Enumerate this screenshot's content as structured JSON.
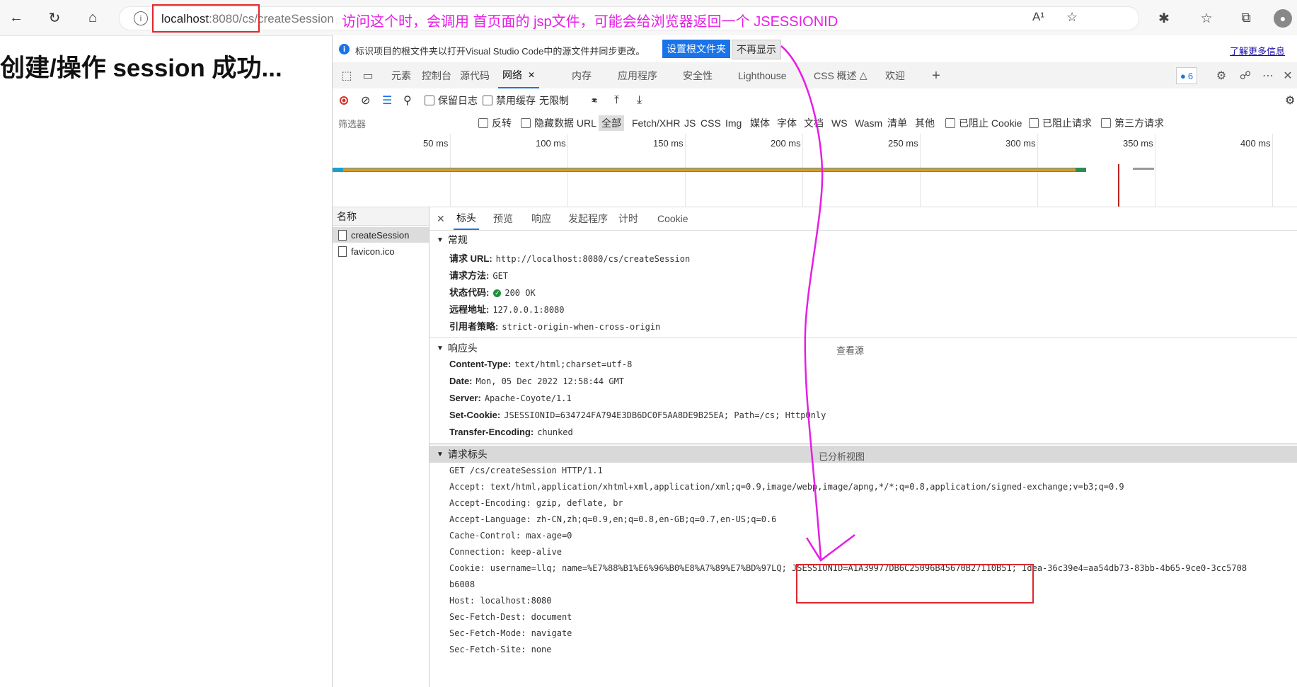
{
  "browser": {
    "url_host": "localhost",
    "url_rest_dim": ":8080/cs/",
    "url_path": "createSession",
    "annotation": "访问这个时，会调用 首页面的 jsp文件，可能会给浏览器返回一个 JSESSIONID",
    "read_aloud": "A¹"
  },
  "page": {
    "heading": "创建/操作 session 成功..."
  },
  "devtools": {
    "infobar": {
      "text": "标识项目的根文件夹以打开Visual Studio Code中的源文件并同步更改。",
      "set_root_button": "设置根文件夹",
      "dismiss_button": "不再显示",
      "learn_more": "了解更多信息"
    },
    "tabs": [
      "元素",
      "控制台",
      "源代码",
      "网络",
      "内存",
      "应用程序",
      "安全性",
      "Lighthouse",
      "CSS 概述",
      "欢迎"
    ],
    "active_tab": "网络",
    "issues_count": "6",
    "toolbar": {
      "preserve_log": "保留日志",
      "disable_cache": "禁用缓存",
      "throttle": "无限制"
    },
    "filter": {
      "placeholder": "筛选器",
      "invert": "反转",
      "hide_data_urls": "隐藏数据 URL",
      "types": [
        "全部",
        "Fetch/XHR",
        "JS",
        "CSS",
        "Img",
        "媒体",
        "字体",
        "文档",
        "WS",
        "Wasm",
        "清单",
        "其他"
      ],
      "blocked_cookies": "已阻止 Cookie",
      "blocked_requests": "已阻止请求",
      "third_party": "第三方请求"
    },
    "timeline_ticks": [
      "50 ms",
      "100 ms",
      "150 ms",
      "200 ms",
      "250 ms",
      "300 ms",
      "350 ms",
      "400 ms"
    ],
    "requests": {
      "header": "名称",
      "items": [
        "createSession",
        "favicon.ico"
      ]
    },
    "detail_tabs": [
      "标头",
      "预览",
      "响应",
      "发起程序",
      "计时",
      "Cookie"
    ],
    "general": {
      "title": "常规",
      "request_url_label": "请求 URL:",
      "request_url": "http://localhost:8080/cs/createSession",
      "method_label": "请求方法:",
      "method": "GET",
      "status_label": "状态代码:",
      "status": "200 OK",
      "remote_label": "远程地址:",
      "remote": "127.0.0.1:8080",
      "referrer_label": "引用者策略:",
      "referrer": "strict-origin-when-cross-origin"
    },
    "response_headers": {
      "title": "响应头",
      "view_source": "查看源",
      "items": [
        {
          "k": "Content-Type:",
          "v": "text/html;charset=utf-8"
        },
        {
          "k": "Date:",
          "v": "Mon, 05 Dec 2022 12:58:44 GMT"
        },
        {
          "k": "Server:",
          "v": "Apache-Coyote/1.1"
        },
        {
          "k": "Set-Cookie:",
          "v": "JSESSIONID=634724FA794E3DB6DC0F5AA8DE9B25EA; Path=/cs; HttpOnly"
        },
        {
          "k": "Transfer-Encoding:",
          "v": "chunked"
        }
      ]
    },
    "request_headers": {
      "title": "请求标头",
      "parsed_view": "已分析视图",
      "lines": [
        "GET /cs/createSession HTTP/1.1",
        "Accept: text/html,application/xhtml+xml,application/xml;q=0.9,image/webp,image/apng,*/*;q=0.8,application/signed-exchange;v=b3;q=0.9",
        "Accept-Encoding: gzip, deflate, br",
        "Accept-Language: zh-CN,zh;q=0.9,en;q=0.8,en-GB;q=0.7,en-US;q=0.6",
        "Cache-Control: max-age=0",
        "Connection: keep-alive",
        "Cookie: username=llq; name=%E7%88%B1%E6%96%B0%E8%A7%89%E7%BD%97LQ; JSESSIONID=A1A39977DB6C25096B45670B27110B51; Idea-36c39e4=aa54db73-83bb-4b65-9ce0-3cc5708",
        "b6008",
        "Host: localhost:8080",
        "Sec-Fetch-Dest: document",
        "Sec-Fetch-Mode: navigate",
        "Sec-Fetch-Site: none"
      ]
    }
  }
}
